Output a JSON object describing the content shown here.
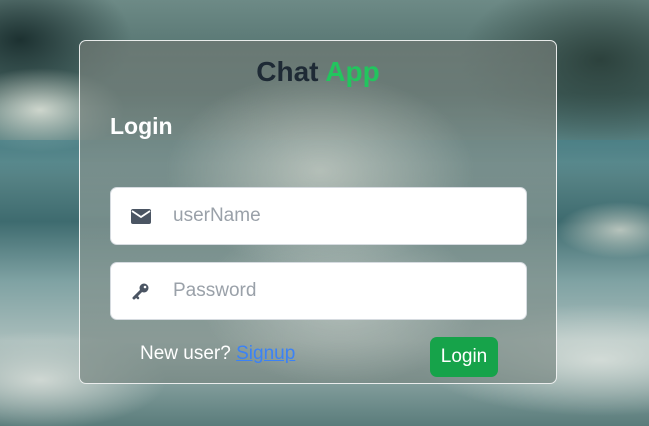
{
  "app": {
    "title_main": "Chat",
    "title_accent": "App",
    "accent_color": "#22c55e",
    "button_color": "#16a34a",
    "link_color": "#3b82f6"
  },
  "form": {
    "heading": "Login",
    "username": {
      "placeholder": "userName",
      "value": "",
      "icon": "envelope-icon"
    },
    "password": {
      "placeholder": "Password",
      "value": "",
      "icon": "key-icon"
    },
    "new_user_text": "New user?",
    "signup_link": "Signup",
    "login_button": "Login"
  }
}
